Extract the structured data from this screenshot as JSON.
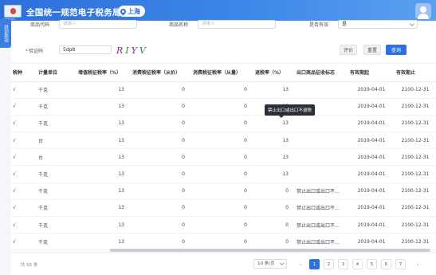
{
  "header": {
    "logo_text": "ARMBOEK",
    "title": "全国统一规范电子税务局",
    "region": "上海"
  },
  "side_tab": {
    "label": "培训助动"
  },
  "filters": {
    "product_code_label": "商品代码",
    "product_code_placeholder": "请输入",
    "product_name_label": "商品名称",
    "product_name_placeholder": "请输入",
    "valid_label": "是否有效",
    "valid_value": "是",
    "captcha_label": "验证码",
    "captcha_value": "5dp8",
    "captcha_chars": [
      "R",
      "I",
      "Y",
      "V"
    ]
  },
  "buttons": {
    "evaluate": "评价",
    "reset": "重置",
    "query": "查询"
  },
  "table": {
    "headers": [
      "税种",
      "计量单位",
      "增值税征税率（%）",
      "消费税征税率（从价）",
      "消费税征税率（从量）",
      "退税率（%）",
      "出口商品征收标志",
      "有效期起",
      "有效期止"
    ],
    "rows": [
      [
        "√",
        "千克",
        "13",
        "0",
        "0",
        "13",
        "",
        "2019-04-01",
        "2100-12-31"
      ],
      [
        "√",
        "千克",
        "13",
        "0",
        "0",
        "13",
        "",
        "2019-04-01",
        "2100-12-31"
      ],
      [
        "√",
        "千克",
        "13",
        "0",
        "0",
        "13",
        "",
        "2019-04-01",
        "2100-12-31"
      ],
      [
        "√",
        "台",
        "13",
        "0",
        "0",
        "13",
        "",
        "2019-04-01",
        "2100-12-31"
      ],
      [
        "√",
        "台",
        "13",
        "0",
        "0",
        "13",
        "",
        "2019-04-01",
        "2100-12-31"
      ],
      [
        "√",
        "千克",
        "13",
        "0",
        "0",
        "13",
        "",
        "2019-04-01",
        "2100-12-31"
      ],
      [
        "√",
        "千克",
        "13",
        "0",
        "0",
        "0",
        "禁止出口或出口不...",
        "2019-04-01",
        "2100-12-31"
      ],
      [
        "√",
        "千克",
        "13",
        "0",
        "0",
        "0",
        "禁止出口或出口不...",
        "2019-04-01",
        "2100-12-31"
      ],
      [
        "√",
        "千克",
        "13",
        "0",
        "0",
        "0",
        "禁止出口或出口不...",
        "2019-04-01",
        "2100-12-31"
      ],
      [
        "√",
        "千克",
        "13",
        "0",
        "0",
        "0",
        "禁止出口或出口不...",
        "2019-04-01",
        "2100-12-31"
      ]
    ],
    "tooltip": "禁止出口或出口不退税"
  },
  "pagination": {
    "total": "共 65 条",
    "page_size": "10 条/页",
    "pages": [
      "1",
      "2",
      "3",
      "4",
      "5",
      "6",
      "7"
    ],
    "current_page": "1",
    "prev": "‹",
    "next": "›"
  },
  "colors": {
    "header": "#2e6fd8",
    "primary": "#2f6fe0",
    "highlight": "#e0452f"
  }
}
